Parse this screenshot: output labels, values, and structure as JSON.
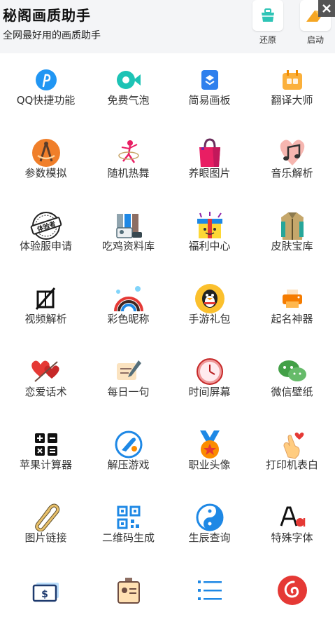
{
  "header": {
    "title": "秘阁画质助手",
    "subtitle": "全网最好用的画质助手",
    "buttons": [
      {
        "label": "还原",
        "icon": "basket-icon"
      },
      {
        "label": "启动",
        "icon": "launch-icon"
      }
    ]
  },
  "grid": {
    "items": [
      {
        "label": "QQ快捷功能",
        "icon": "qq-shortcut-icon"
      },
      {
        "label": "免费气泡",
        "icon": "bubble-icon"
      },
      {
        "label": "简易画板",
        "icon": "sketchpad-icon"
      },
      {
        "label": "翻译大师",
        "icon": "translate-icon"
      },
      {
        "label": "参数模拟",
        "icon": "compass-icon"
      },
      {
        "label": "随机热舞",
        "icon": "dancer-icon"
      },
      {
        "label": "养眼图片",
        "icon": "shopping-bag-icon"
      },
      {
        "label": "音乐解析",
        "icon": "music-note-icon"
      },
      {
        "label": "体验服申请",
        "icon": "trial-stamp-icon"
      },
      {
        "label": "吃鸡资料库",
        "icon": "library-icon"
      },
      {
        "label": "福利中心",
        "icon": "gift-box-icon"
      },
      {
        "label": "皮肤宝库",
        "icon": "jacket-icon"
      },
      {
        "label": "视频解析",
        "icon": "video-off-icon"
      },
      {
        "label": "彩色昵称",
        "icon": "rainbow-icon"
      },
      {
        "label": "手游礼包",
        "icon": "penguin-icon"
      },
      {
        "label": "起名神器",
        "icon": "printer-icon"
      },
      {
        "label": "恋爱话术",
        "icon": "hearts-icon"
      },
      {
        "label": "每日一句",
        "icon": "note-pen-icon"
      },
      {
        "label": "时间屏幕",
        "icon": "clock-icon"
      },
      {
        "label": "微信壁纸",
        "icon": "wechat-icon"
      },
      {
        "label": "苹果计算器",
        "icon": "calculator-icon"
      },
      {
        "label": "解压游戏",
        "icon": "gamepad-icon"
      },
      {
        "label": "职业头像",
        "icon": "medal-icon"
      },
      {
        "label": "打印机表白",
        "icon": "finger-heart-icon"
      },
      {
        "label": "图片链接",
        "icon": "paperclip-icon"
      },
      {
        "label": "二维码生成",
        "icon": "qrcode-icon"
      },
      {
        "label": "生辰查询",
        "icon": "yin-yang-icon"
      },
      {
        "label": "特殊字体",
        "icon": "font-icon"
      },
      {
        "label": "",
        "icon": "dollar-bill-icon"
      },
      {
        "label": "",
        "icon": "id-badge-icon"
      },
      {
        "label": "",
        "icon": "list-icon"
      },
      {
        "label": "",
        "icon": "netease-music-icon"
      }
    ]
  }
}
